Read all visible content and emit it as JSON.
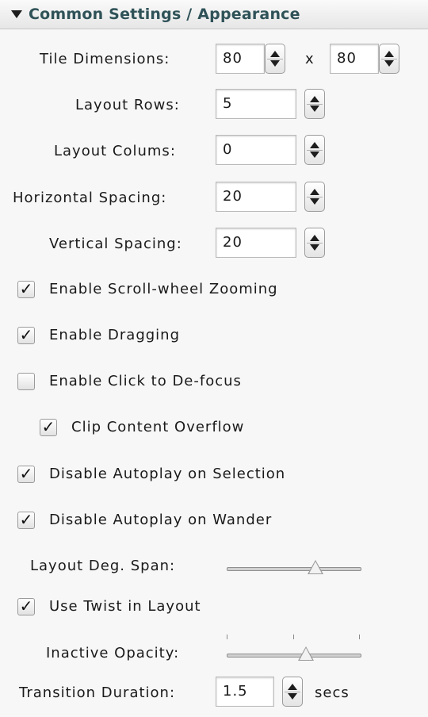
{
  "header": {
    "title": "Common Settings / Appearance"
  },
  "tile_dimensions": {
    "label": "Tile Dimensions:",
    "width": "80",
    "separator": "x",
    "height": "80"
  },
  "layout_rows": {
    "label": "Layout Rows:",
    "value": "5"
  },
  "layout_columns": {
    "label": "Layout Colums:",
    "value": "0"
  },
  "horizontal_spacing": {
    "label": "Horizontal Spacing:",
    "value": "20"
  },
  "vertical_spacing": {
    "label": "Vertical Spacing:",
    "value": "20"
  },
  "checkboxes": {
    "scroll_zoom": {
      "label": "Enable Scroll-wheel Zooming",
      "checked": true
    },
    "dragging": {
      "label": "Enable Dragging",
      "checked": true
    },
    "click_defocus": {
      "label": "Enable Click to De-focus",
      "checked": false
    },
    "clip_overflow": {
      "label": "Clip Content Overflow",
      "checked": true
    },
    "autoplay_selection": {
      "label": "Disable Autoplay on Selection",
      "checked": true
    },
    "autoplay_wander": {
      "label": "Disable Autoplay on Wander",
      "checked": true
    },
    "twist_layout": {
      "label": "Use Twist in Layout",
      "checked": true
    }
  },
  "layout_deg_span": {
    "label": "Layout Deg. Span:",
    "level": 0.66
  },
  "inactive_opacity": {
    "label": "Inactive Opacity:",
    "level": 0.59
  },
  "transition_duration": {
    "label": "Transition Duration:",
    "value": "1.5",
    "unit": "secs"
  },
  "check_glyph": "✓",
  "colors": {
    "header_text": "#2f5258"
  }
}
